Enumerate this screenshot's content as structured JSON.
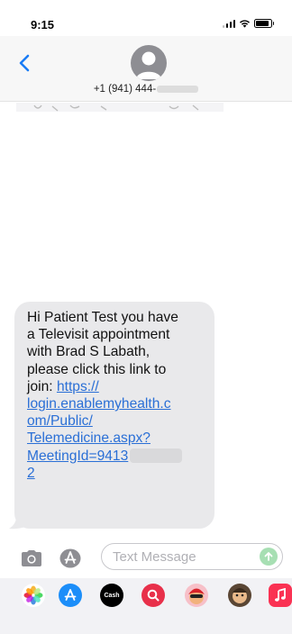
{
  "status_bar": {
    "time": "9:15"
  },
  "header": {
    "contact_number": "+1 (941) 444-"
  },
  "message": {
    "intro_lines": [
      "Hi Patient Test you have",
      "a Televisit appointment",
      "with Brad  S Labath,",
      "please click this link to"
    ],
    "join_label": "join:",
    "link_lines": [
      "https://",
      "login.enablemyhealth.c",
      "om/Public/",
      "Telemedicine.aspx?",
      "MeetingId=9413"
    ],
    "link_end": "2"
  },
  "compose": {
    "placeholder": "Text Message"
  },
  "app_drawer": {
    "apps": [
      {
        "name": "photos-app-icon",
        "color": "#ffffff"
      },
      {
        "name": "app-store-icon",
        "color": "#1c8ef9"
      },
      {
        "name": "apple-cash-icon",
        "color": "#000000",
        "label": "Cash"
      },
      {
        "name": "search-images-icon",
        "color": "#e8304a"
      },
      {
        "name": "memoji-icon",
        "color": "#f7c0c8"
      },
      {
        "name": "animoji-icon",
        "color": "#5a4634"
      },
      {
        "name": "music-app-icon",
        "color": "#fa3253"
      }
    ]
  }
}
